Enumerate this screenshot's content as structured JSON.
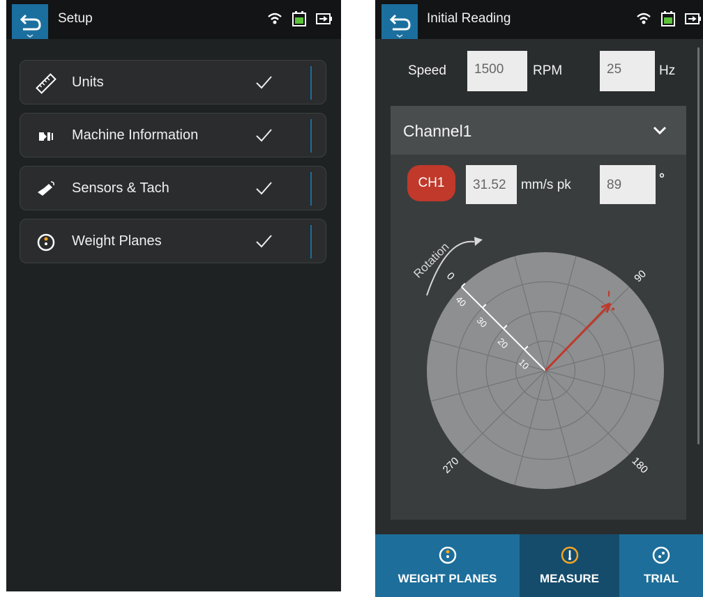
{
  "setup": {
    "title": "Setup",
    "items": [
      {
        "label": "Units",
        "icon": "ruler-icon"
      },
      {
        "label": "Machine Information",
        "icon": "machine-icon"
      },
      {
        "label": "Sensors & Tach",
        "icon": "sensor-icon"
      },
      {
        "label": "Weight Planes",
        "icon": "weight-plane-icon"
      }
    ]
  },
  "reading": {
    "title": "Initial Reading",
    "speed_label": "Speed",
    "speed_rpm": "1500",
    "rpm_unit": "RPM",
    "speed_hz": "25",
    "hz_unit": "Hz",
    "channel_title": "Channel1",
    "channel_chip": "CH1",
    "amplitude": "31.52",
    "amplitude_unit": "mm/s pk",
    "phase": "89",
    "phase_unit": "°",
    "rotation_label": "Rotation",
    "angle_labels": [
      "0",
      "270",
      "180",
      "90"
    ],
    "radial_labels": [
      "40",
      "30",
      "20",
      "10"
    ],
    "vector": {
      "magnitude": 31.52,
      "phase_deg": 89
    }
  },
  "tabs": [
    {
      "label": "WEIGHT PLANES",
      "icon": "weight-plane-icon"
    },
    {
      "label": "MEASURE",
      "icon": "gauge-icon"
    },
    {
      "label": "TRIAL",
      "icon": "trial-icon"
    }
  ],
  "colors": {
    "accent": "#1b6f9f",
    "status_red": "#c0392b",
    "indicator": "#f5a623"
  }
}
